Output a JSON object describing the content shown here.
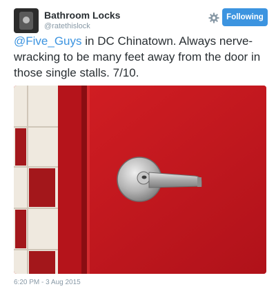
{
  "user": {
    "display_name": "Bathroom Locks",
    "handle": "@ratethislock",
    "avatar_icon": "door-lock-icon"
  },
  "header": {
    "settings_icon": "gear-icon",
    "follow_label": "Following",
    "follow_color": "#3c94e0"
  },
  "tweet": {
    "mention": "@Five_Guys",
    "text": " in DC Chinatown. Always nerve-wracking to be many feet away from the door in those single stalls. 7/10."
  },
  "media": {
    "subject": "red-stall-door-with-lever-lock",
    "door_color": "#c8171c"
  },
  "meta": {
    "timestamp": "6:20 PM - 3 Aug 2015"
  }
}
